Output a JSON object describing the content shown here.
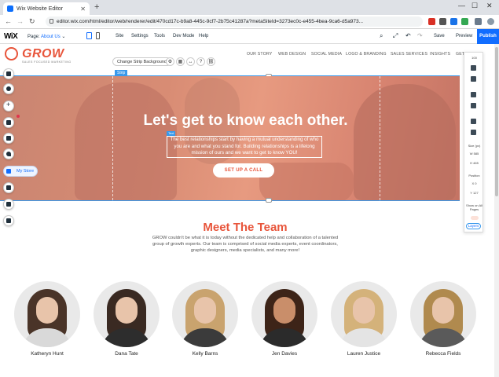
{
  "browser": {
    "tab_title": "Wix Website Editor",
    "url": "editor.wix.com/html/editor/web/renderer/edit/470cd17c-b9a8-445c-9cf7-2b75c41287a?metaSiteId=3273ec0c-e455-4bea-9ca6-d5a973..."
  },
  "editor": {
    "logo": "WiX",
    "page_label": "Page:",
    "page_value": "About Us",
    "menu": [
      "Site",
      "Settings",
      "Tools",
      "Dev Mode",
      "Help"
    ],
    "save": "Save",
    "preview": "Preview",
    "publish": "Publish"
  },
  "site": {
    "logo_text": "GROW",
    "logo_tagline": "SALES FOCUSED MARKETING",
    "nav": [
      "OUR STORY",
      "WEB DESIGN",
      "SOCIAL MEDIA",
      "LOGO & BRANDING",
      "SALES SERVICES",
      "INSIGHTS",
      "GET STARTED"
    ]
  },
  "strip_toolbar": {
    "change_bg": "Change Strip Background",
    "strip_label": "Strip",
    "text_label": "Text"
  },
  "hero": {
    "title": "Let's get to know each other.",
    "body": "The best relationships start by having a mutual understanding of who you are and what you stand for. Building relationships is a lifelong mission of ours and we want to get to know YOU!",
    "cta": "SET UP A CALL"
  },
  "left_toolbar": {
    "my_store": "My Store"
  },
  "right_panel": {
    "size_label": "Size (px)",
    "w_label": "W",
    "w_value": "585",
    "h_label": "H",
    "h_value": "465",
    "position_label": "Position",
    "x_label": "X",
    "x_value": "0",
    "y_label": "Y",
    "y_value": "127",
    "show_all_pages": "Show on All Pages",
    "layers": "Layers",
    "zoom": "100"
  },
  "team": {
    "title": "Meet The Team",
    "intro": "GROW couldn't be what it is today without the dedicated help and collaboration of a talented group of growth experts. Our team is comprised of social media experts, event coordinators, graphic designers, media specialists, and many more!",
    "members": [
      {
        "name": "Katheryn Hunt"
      },
      {
        "name": "Dana Tate"
      },
      {
        "name": "Kelly Barns"
      },
      {
        "name": "Jen Davies"
      },
      {
        "name": "Lauren Justice"
      },
      {
        "name": "Rebecca Fields"
      }
    ]
  },
  "colors": {
    "accent": "#e8553b",
    "wix_blue": "#116dff",
    "selection_blue": "#3899ec"
  }
}
